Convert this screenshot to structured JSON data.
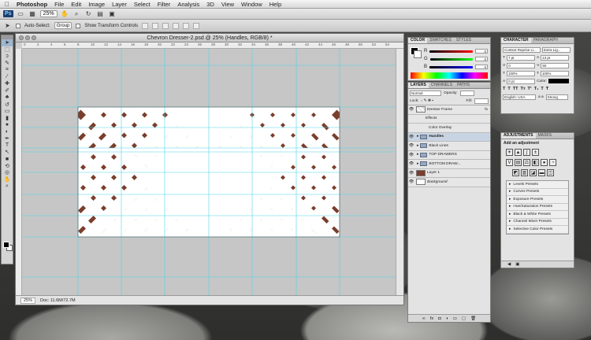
{
  "menubar": {
    "apple": "",
    "app": "Photoshop",
    "items": [
      "File",
      "Edit",
      "Image",
      "Layer",
      "Select",
      "Filter",
      "Analysis",
      "3D",
      "View",
      "Window",
      "Help"
    ]
  },
  "appbar": {
    "ps_logo": "Ps",
    "zoom": "25%"
  },
  "options": {
    "auto_select_label": "Auto-Select:",
    "auto_select_value": "Group",
    "show_transform_label": "Show Transform Controls"
  },
  "document": {
    "title": "Chevron Dresser-2.psd @ 25% (Handles, RGB/8) *",
    "zoom": "25%",
    "doc_size": "Doc: 11.6M/72.7M",
    "ruler_ticks": [
      "0",
      "2",
      "4",
      "6",
      "8",
      "10",
      "12",
      "14",
      "16",
      "18",
      "20",
      "22",
      "24",
      "26",
      "28",
      "30",
      "32",
      "34",
      "36",
      "38",
      "40",
      "42",
      "44",
      "46",
      "48",
      "50",
      "52",
      "54"
    ]
  },
  "color_panel": {
    "tabs": [
      "COLOR",
      "SWATCHES",
      "STYLES"
    ],
    "channels": [
      {
        "label": "R",
        "value": "0"
      },
      {
        "label": "G",
        "value": "0"
      },
      {
        "label": "B",
        "value": "0"
      }
    ]
  },
  "layers_panel": {
    "tabs": [
      "LAYERS",
      "CHANNELS",
      "PATHS"
    ],
    "blend_mode": "Normal",
    "opacity_label": "Opacity:",
    "lock_label": "Lock:",
    "fill_label": "Fill:",
    "layers": [
      {
        "name": "Dresser Frame",
        "fx": "fx",
        "type": "thumb"
      },
      {
        "name": "Effects",
        "type": "sub"
      },
      {
        "name": "Color Overlay",
        "type": "sub2"
      },
      {
        "name": "Handles",
        "type": "folder",
        "selected": true
      },
      {
        "name": "Black Lines",
        "type": "folder"
      },
      {
        "name": "TOP DRAWERS",
        "type": "folder"
      },
      {
        "name": "BOTTOM DRAW...",
        "type": "folder"
      },
      {
        "name": "Layer 1",
        "type": "brown"
      },
      {
        "name": "Background",
        "type": "white"
      }
    ]
  },
  "character_panel": {
    "tabs": [
      "CHARACTER",
      "PARAGRAPH"
    ],
    "font": "Context Reprise Li...",
    "style": "Extra Lig...",
    "size": "7 pt",
    "leading": "13 pt",
    "tracking": "0",
    "kerning": "50",
    "vscale": "100%",
    "hscale": "100%",
    "baseline": "0 pt",
    "color_label": "Color:",
    "language": "English: USA",
    "aa_label": "a a",
    "aa": "Strong"
  },
  "adjustments_panel": {
    "tabs": [
      "ADJUSTMENTS",
      "MASKS"
    ],
    "heading": "Add an adjustment",
    "presets": [
      "Levels Presets",
      "Curves Presets",
      "Exposure Presets",
      "Hue/Saturation Presets",
      "Black & White Presets",
      "Channel Mixer Presets",
      "Selective Color Presets"
    ]
  },
  "colors": {
    "brown": "#7a3e2c",
    "guide": "#4fd3e8"
  }
}
